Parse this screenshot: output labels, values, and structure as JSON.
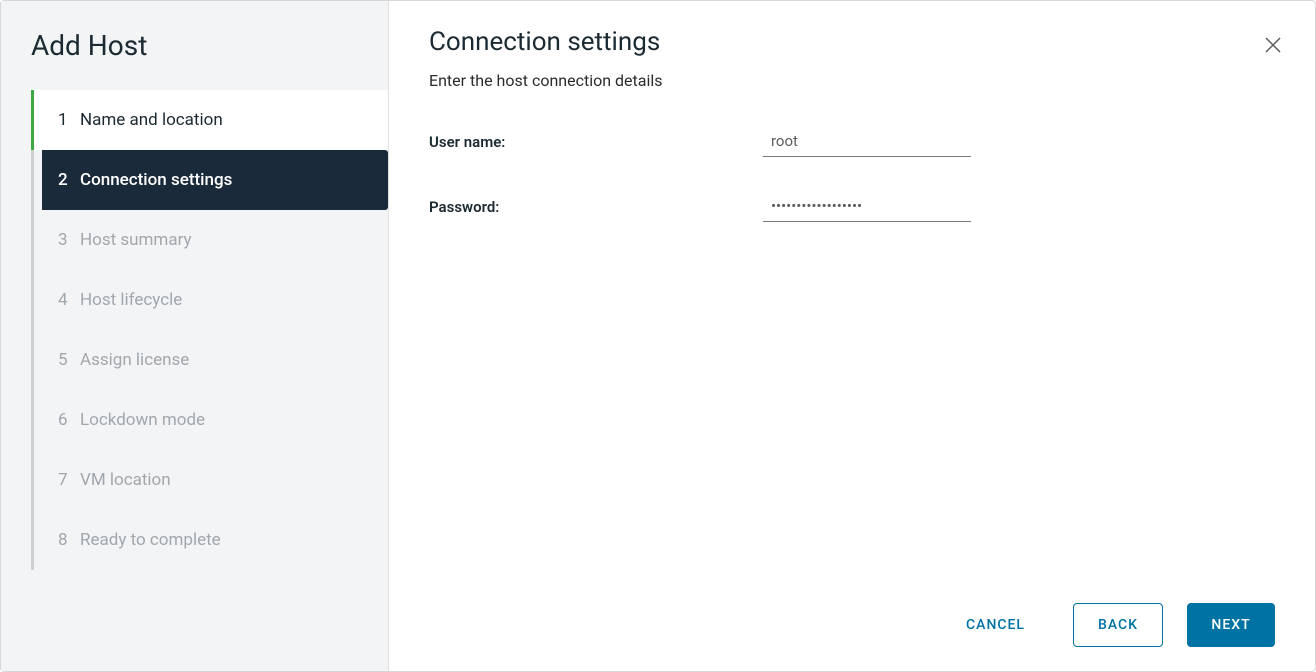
{
  "sidebar": {
    "title": "Add Host",
    "steps": [
      {
        "num": "1",
        "label": "Name and location",
        "state": "completed"
      },
      {
        "num": "2",
        "label": "Connection settings",
        "state": "active"
      },
      {
        "num": "3",
        "label": "Host summary",
        "state": "upcoming"
      },
      {
        "num": "4",
        "label": "Host lifecycle",
        "state": "upcoming"
      },
      {
        "num": "5",
        "label": "Assign license",
        "state": "upcoming"
      },
      {
        "num": "6",
        "label": "Lockdown mode",
        "state": "upcoming"
      },
      {
        "num": "7",
        "label": "VM location",
        "state": "upcoming"
      },
      {
        "num": "8",
        "label": "Ready to complete",
        "state": "upcoming"
      }
    ]
  },
  "main": {
    "title": "Connection settings",
    "subtitle": "Enter the host connection details",
    "fields": {
      "username": {
        "label": "User name:",
        "value": "root"
      },
      "password": {
        "label": "Password:",
        "value": "••••••••••••••••••"
      }
    }
  },
  "footer": {
    "cancel": "CANCEL",
    "back": "BACK",
    "next": "NEXT"
  }
}
